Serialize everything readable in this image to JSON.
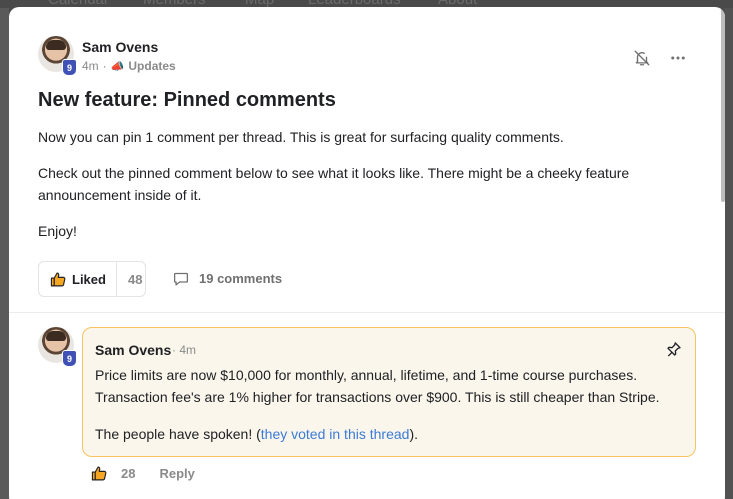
{
  "background_nav": [
    "Calendar",
    "Members",
    "Map",
    "Leaderboards",
    "About"
  ],
  "post": {
    "author": "Sam Ovens",
    "author_level": "9",
    "time": "4m",
    "separator": "·",
    "category_icon": "megaphone-icon",
    "category": "Updates",
    "title": "New feature: Pinned comments",
    "paragraphs": [
      "Now you can pin 1 comment per thread. This is great for surfacing quality comments.",
      "Check out the pinned comment below to see what it looks like. There might be a cheeky feature announcement inside of it.",
      "Enjoy!"
    ],
    "like_label": "Liked",
    "like_count": "48",
    "comments_label": "19 comments"
  },
  "comment": {
    "author": "Sam Ovens",
    "author_level": "9",
    "time": "· 4m",
    "paragraph1": "Price limits are now $10,000 for monthly, annual, lifetime, and 1-time course purchases. Transaction fee's are 1% higher for transactions over $900. This is still cheaper than Stripe.",
    "paragraph2_before": "The people have spoken! (",
    "paragraph2_link": "they voted in this thread",
    "paragraph2_after": ").",
    "like_count": "28",
    "reply_label": "Reply"
  },
  "colors": {
    "accent_blue": "#3b7bd8",
    "pinned_border": "#f7c35f",
    "pinned_bg": "#fbf6ec",
    "level_badge": "#3f51b5",
    "like_icon": "#f5a623"
  }
}
